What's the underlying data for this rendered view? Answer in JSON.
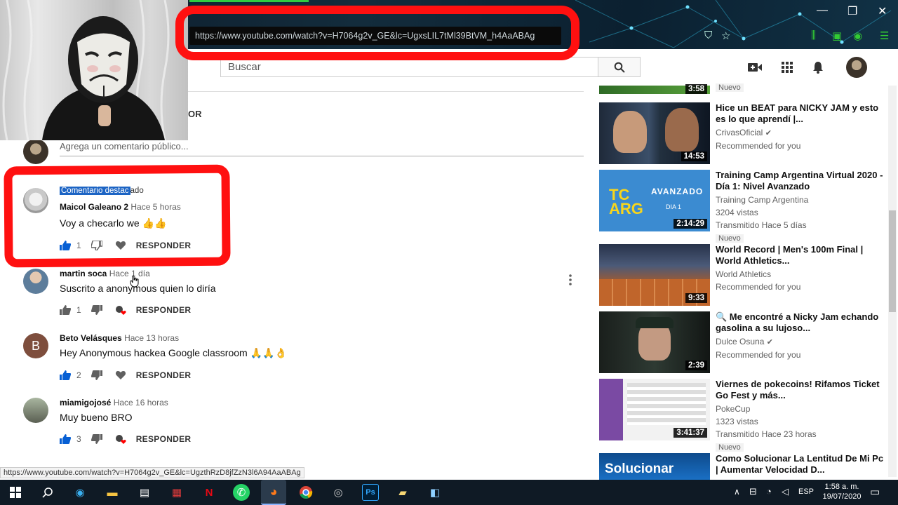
{
  "browser": {
    "url": "https://www.youtube.com/watch?v=H7064g2v_GE&lc=UgxsLIL7tMl39BtVM_h4AaABAg",
    "url_domain": "youtube.com"
  },
  "header": {
    "search_placeholder": "Buscar"
  },
  "comments_section": {
    "sort_fragment": "OR",
    "add_comment_placeholder": "Agrega un comentario público...",
    "pinned_label_selected": "Comentario destac",
    "pinned_label_rest": "ado",
    "reply_label": "RESPONDER",
    "comments": [
      {
        "author": "Maicol Galeano 2",
        "time": "Hace 5 horas",
        "text": "Voy a checarlo we 👍👍",
        "likes": "1"
      },
      {
        "author": "martin soca",
        "time": "Hace 1 día",
        "text": "Suscrito a anonymous quien lo diría",
        "likes": "1"
      },
      {
        "author": "Beto Velásques",
        "time": "Hace 13 horas",
        "text": "Hey Anonymous hackea Google classroom 🙏🙏👌",
        "likes": "2",
        "avatar_letter": "B"
      },
      {
        "author": "miamigojosé",
        "time": "Hace 16 horas",
        "text": "Muy bueno BRO",
        "likes": "3"
      }
    ]
  },
  "sidebar": {
    "top_partial": {
      "duration": "3:58",
      "badge": "Nuevo"
    },
    "videos": [
      {
        "title": "Hice un BEAT para NICKY JAM y esto es lo que aprendí |...",
        "channel": "CrivasOficial",
        "verified": true,
        "line2": "Recommended for you",
        "line3": "",
        "badge": "",
        "duration": "14:53"
      },
      {
        "title": "Training Camp Argentina Virtual 2020 - Día 1: Nivel Avanzado",
        "channel": "Training Camp Argentina",
        "verified": false,
        "line2": "3204 vistas",
        "line3": "Transmitido Hace 5 días",
        "badge": "Nuevo",
        "duration": "2:14:29",
        "thumb_text_1": "TC",
        "thumb_text_2": "ARG",
        "thumb_text_3": "AVANZADO",
        "thumb_text_4": "DIA 1"
      },
      {
        "title": "World Record | Men's 100m Final | World Athletics...",
        "channel": "World Athletics",
        "verified": false,
        "line2": "Recommended for you",
        "line3": "",
        "badge": "",
        "duration": "9:33"
      },
      {
        "title": "🔍 Me encontré a Nicky Jam echando gasolina a su lujoso...",
        "channel": "Dulce Osuna",
        "verified": true,
        "line2": "Recommended for you",
        "line3": "",
        "badge": "",
        "duration": "2:39"
      },
      {
        "title": "Viernes de pokecoins! Rifamos Ticket Go Fest y más...",
        "channel": "PokeCup",
        "verified": false,
        "line2": "1323 vistas",
        "line3": "Transmitido Hace 23 horas",
        "badge": "Nuevo",
        "duration": "3:41:37"
      },
      {
        "title": "Como Solucionar La Lentitud De Mi Pc | Aumentar Velocidad D...",
        "channel": "",
        "verified": false,
        "line2": "",
        "line3": "",
        "badge": "",
        "duration": "",
        "thumb_text_1": "Solucionar"
      }
    ]
  },
  "status_url": "https://www.youtube.com/watch?v=H7064g2v_GE&lc=UgzthRzD8jfZzN3l6A94AaABAg",
  "taskbar": {
    "lang": "ESP",
    "time": "1:58 a. m.",
    "date": "19/07/2020"
  },
  "colors": {
    "highlight_red": "#ff1010",
    "link_blue": "#065fd4",
    "taskbar": "#0f1a25"
  }
}
